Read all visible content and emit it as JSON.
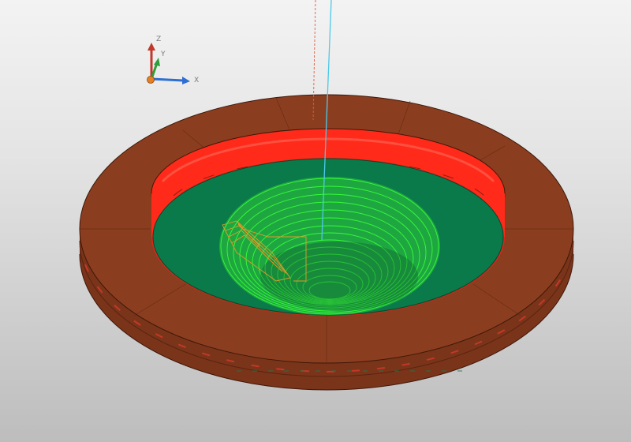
{
  "viewport": {
    "background_top": "#f3f3f3",
    "background_bottom": "#bdbdbd"
  },
  "axis_triad": {
    "x_label": "X",
    "y_label": "Y",
    "z_label": "Z",
    "x_color": "#2e6fd1",
    "y_color": "#2e9e3a",
    "z_color": "#c0392b",
    "origin_color": "#e67e22"
  },
  "model": {
    "rim_color": "#8b3e1f",
    "rim_side_color": "#7a341a",
    "pocket_wall_color": "#ff2a1a",
    "floor_color": "#0b7a4a",
    "toolpath_color": "#33e033",
    "toolpath_entry_color": "#e69a2a",
    "tool_axis_color": "#4fc8e8",
    "tool_axis_dashed_color": "#e05a3a"
  }
}
